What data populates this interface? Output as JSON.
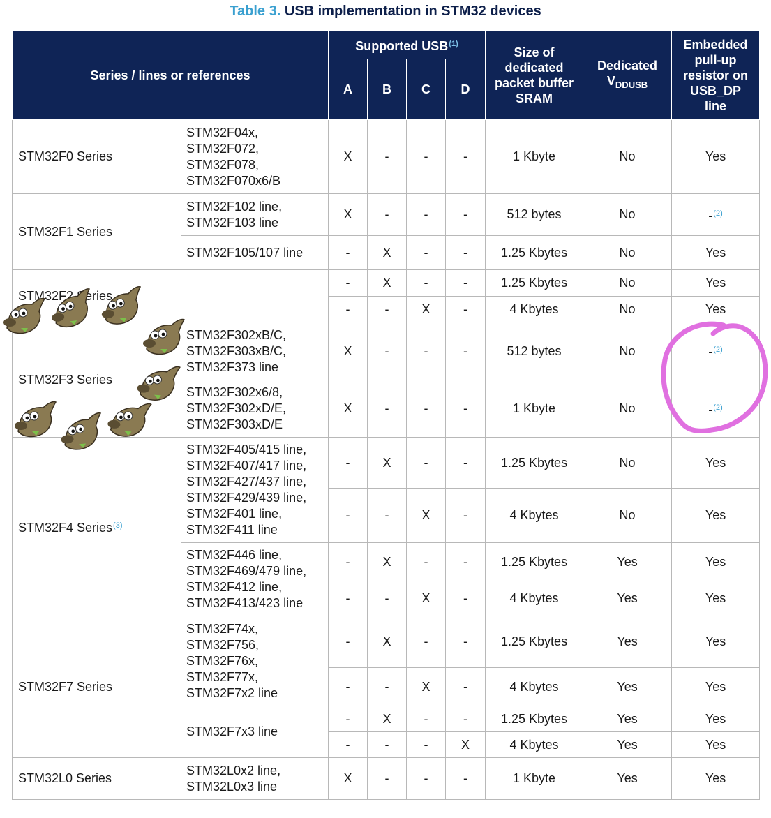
{
  "caption": {
    "number": "Table 3.",
    "title": "USB implementation in STM32 devices"
  },
  "header": {
    "series": "Series / lines or references",
    "supported_usb": "Supported USB",
    "supported_usb_footnote": "(1)",
    "usb_types": [
      "A",
      "B",
      "C",
      "D"
    ],
    "buffer": "Size of dedicated packet buffer SRAM",
    "vddusb_prefix": "Dedicated",
    "vddusb_v": "V",
    "vddusb_sub": "DDUSB",
    "pullup": "Embedded pull-up resistor on USB_DP line"
  },
  "rows": [
    {
      "series": "STM32F0 Series",
      "lines": [
        "STM32F04x,",
        "STM32F072,",
        "STM32F078,",
        "STM32F070x6/B"
      ],
      "a": "X",
      "b": "-",
      "c": "-",
      "d": "-",
      "buffer": "1 Kbyte",
      "vdd": "No",
      "pullup": "Yes"
    },
    {
      "series": "STM32F1 Series",
      "lines": [
        "STM32F102 line,",
        "STM32F103 line"
      ],
      "a": "X",
      "b": "-",
      "c": "-",
      "d": "-",
      "buffer": "512 bytes",
      "vdd": "No",
      "pullup": "-",
      "pullup_fn": "(2)"
    },
    {
      "lines": [
        "STM32F105/107 line"
      ],
      "a": "-",
      "b": "X",
      "c": "-",
      "d": "-",
      "buffer": "1.25 Kbytes",
      "vdd": "No",
      "pullup": "Yes"
    },
    {
      "series": "STM32F2 Series",
      "a": "-",
      "b": "X",
      "c": "-",
      "d": "-",
      "buffer": "1.25 Kbytes",
      "vdd": "No",
      "pullup": "Yes"
    },
    {
      "a": "-",
      "b": "-",
      "c": "X",
      "d": "-",
      "buffer": "4 Kbytes",
      "vdd": "No",
      "pullup": "Yes"
    },
    {
      "series": "STM32F3 Series",
      "lines": [
        "STM32F302xB/C,",
        "STM32F303xB/C,",
        "STM32F373 line"
      ],
      "a": "X",
      "b": "-",
      "c": "-",
      "d": "-",
      "buffer": "512 bytes",
      "vdd": "No",
      "pullup": "-",
      "pullup_fn": "(2)"
    },
    {
      "lines": [
        "STM32F302x6/8,",
        "STM32F302xD/E,",
        "STM32F303xD/E"
      ],
      "a": "X",
      "b": "-",
      "c": "-",
      "d": "-",
      "buffer": "1 Kbyte",
      "vdd": "No",
      "pullup": "-",
      "pullup_fn": "(2)"
    },
    {
      "series": "STM32F4 Series",
      "series_fn": "(3)",
      "lines": [
        "STM32F405/415 line,",
        "STM32F407/417 line,",
        "STM32F427/437 line,",
        "STM32F429/439 line,",
        "STM32F401 line,",
        "STM32F411 line"
      ],
      "a": "-",
      "b": "X",
      "c": "-",
      "d": "-",
      "buffer": "1.25 Kbytes",
      "vdd": "No",
      "pullup": "Yes"
    },
    {
      "a": "-",
      "b": "-",
      "c": "X",
      "d": "-",
      "buffer": "4 Kbytes",
      "vdd": "No",
      "pullup": "Yes"
    },
    {
      "lines": [
        "STM32F446 line,",
        "STM32F469/479 line,",
        "STM32F412 line,",
        "STM32F413/423 line"
      ],
      "a": "-",
      "b": "X",
      "c": "-",
      "d": "-",
      "buffer": "1.25 Kbytes",
      "vdd": "Yes",
      "pullup": "Yes"
    },
    {
      "a": "-",
      "b": "-",
      "c": "X",
      "d": "-",
      "buffer": "4 Kbytes",
      "vdd": "Yes",
      "pullup": "Yes"
    },
    {
      "series": "STM32F7 Series",
      "lines": [
        "STM32F74x,",
        "STM32F756,",
        "STM32F76x,",
        "STM32F77x,",
        "STM32F7x2 line"
      ],
      "a": "-",
      "b": "X",
      "c": "-",
      "d": "-",
      "buffer": "1.25 Kbytes",
      "vdd": "Yes",
      "pullup": "Yes"
    },
    {
      "a": "-",
      "b": "-",
      "c": "X",
      "d": "-",
      "buffer": "4 Kbytes",
      "vdd": "Yes",
      "pullup": "Yes"
    },
    {
      "lines": [
        "STM32F7x3 line"
      ],
      "a": "-",
      "b": "X",
      "c": "-",
      "d": "-",
      "buffer": "1.25 Kbytes",
      "vdd": "Yes",
      "pullup": "Yes"
    },
    {
      "a": "-",
      "b": "-",
      "c": "-",
      "d": "X",
      "buffer": "4 Kbytes",
      "vdd": "Yes",
      "pullup": "Yes"
    },
    {
      "series": "STM32L0 Series",
      "lines": [
        "STM32L0x2 line,",
        "STM32L0x3 line"
      ],
      "a": "X",
      "b": "-",
      "c": "-",
      "d": "-",
      "buffer": "1 Kbyte",
      "vdd": "Yes",
      "pullup": "Yes"
    }
  ],
  "colors": {
    "header_bg": "#0f2456",
    "caption_number": "#3aa0d0",
    "caption_title": "#0d1f4a",
    "footnote": "#3aa0d0",
    "highlight": "#e070e0"
  },
  "overlay_icons": [
    "wilber-mascot-icon"
  ]
}
